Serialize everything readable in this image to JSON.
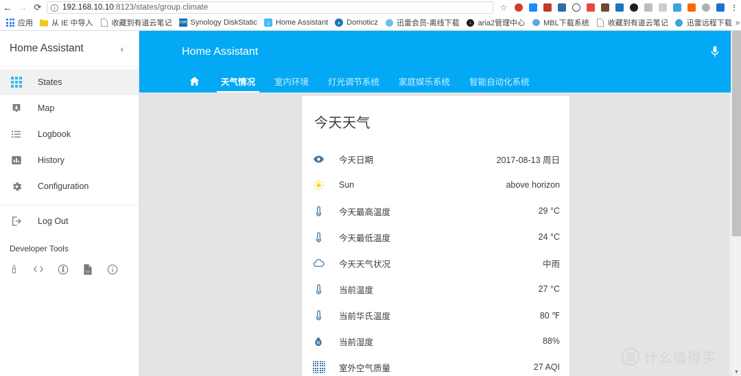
{
  "browser": {
    "back_icon": "back-arrow-icon",
    "forward_icon": "forward-arrow-icon",
    "reload_icon": "reload-icon",
    "url_host": "192.168.10.10",
    "url_rest": ":8123/states/group.climate",
    "url_full": "192.168.10.10:8123/states/group.climate",
    "star_icon": "bookmark-star-icon",
    "menu_icon": "browser-menu-icon",
    "extensions": [
      {
        "name": "evernote-extension",
        "color": "#d83c2a"
      },
      {
        "name": "pocket-extension",
        "color": "#1a8cff"
      },
      {
        "name": "speed-test-100-extension",
        "color": "#c0392b"
      },
      {
        "name": "image-downloader-extension",
        "color": "#2c6ea8"
      },
      {
        "name": "one-password-extension",
        "color": "#4a4a4a"
      },
      {
        "name": "dictionary-extension",
        "color": "#e8453c"
      },
      {
        "name": "ink-extension",
        "color": "#6b4a2a"
      },
      {
        "name": "sogou-extension",
        "color": "#1b75bb"
      },
      {
        "name": "chameleon-extension",
        "color": "#1f1f1f"
      },
      {
        "name": "elephant-extension",
        "color": "#b9bdc0"
      },
      {
        "name": "shield-extension",
        "color": "#b9bdc0"
      },
      {
        "name": "xunlei-extension",
        "color": "#3ba6dc"
      },
      {
        "name": "xiaomi-extension",
        "color": "#ff6700"
      },
      {
        "name": "moon-extension",
        "color": "#b0b0b0"
      },
      {
        "name": "bluetab-extension",
        "color": "#1f6fd0"
      }
    ]
  },
  "bookmarks": {
    "overflow_label": "»",
    "items": [
      {
        "label": "应用",
        "icon": "apps-grid-icon",
        "icon_color": "#4285f4"
      },
      {
        "label": "从 IE 中导入",
        "icon": "folder-icon",
        "icon_color": "#f5c518"
      },
      {
        "label": "收藏到有道云笔记",
        "icon": "page-icon",
        "icon_color": "#9aa0a6"
      },
      {
        "label": "Synology DiskStatic",
        "icon": "dsm-icon",
        "icon_color": "#1a6fb5"
      },
      {
        "label": "Home Assistant",
        "icon": "home-assistant-icon",
        "icon_color": "#41bdf5"
      },
      {
        "label": "Domoticz",
        "icon": "domoticz-icon",
        "icon_color": "#1b75bb"
      },
      {
        "label": "迅雷会员-离线下载",
        "icon": "thunder-member-icon",
        "icon_color": "#6cc0e8"
      },
      {
        "label": "aria2管理中心",
        "icon": "aria2-icon",
        "icon_color": "#1f1f1f"
      },
      {
        "label": "MBL下载系统",
        "icon": "mbl-icon",
        "icon_color": "#5aa9dd"
      },
      {
        "label": "收藏到有道云笔记",
        "icon": "page-icon",
        "icon_color": "#9aa0a6"
      },
      {
        "label": "迅雷远程下载",
        "icon": "thunder-remote-icon",
        "icon_color": "#3ba6dc"
      }
    ]
  },
  "sidebar": {
    "title": "Home Assistant",
    "collapse_icon": "chevron-left-icon",
    "items": [
      {
        "label": "States",
        "icon": "states-grid-icon",
        "active": true
      },
      {
        "label": "Map",
        "icon": "map-marker-icon",
        "active": false
      },
      {
        "label": "Logbook",
        "icon": "logbook-list-icon",
        "active": false
      },
      {
        "label": "History",
        "icon": "history-chart-icon",
        "active": false
      },
      {
        "label": "Configuration",
        "icon": "gear-icon",
        "active": false
      },
      {
        "label": "Log Out",
        "icon": "logout-icon",
        "active": false
      }
    ],
    "developer_tools": {
      "title": "Developer Tools",
      "icons": [
        {
          "name": "remote-services-icon"
        },
        {
          "name": "code-templates-icon"
        },
        {
          "name": "events-broadcast-icon"
        },
        {
          "name": "states-file-icon"
        },
        {
          "name": "info-icon"
        }
      ]
    }
  },
  "appbar": {
    "title": "Home Assistant",
    "mic_icon": "microphone-icon",
    "accent_color": "#03a9f4",
    "tabs": [
      {
        "label": "",
        "icon": "home-icon",
        "active": false
      },
      {
        "label": "天气情况",
        "active": true
      },
      {
        "label": "室内环境",
        "active": false
      },
      {
        "label": "灯光调节系统",
        "active": false
      },
      {
        "label": "家庭娱乐系统",
        "active": false
      },
      {
        "label": "智能自动化系统",
        "active": false
      }
    ]
  },
  "card": {
    "title": "今天天气",
    "rows": [
      {
        "icon": "eye-icon",
        "icon_color": "#44739e",
        "name": "今天日期",
        "value": "2017-08-13 周日"
      },
      {
        "icon": "sun-icon",
        "icon_color": "#fdd835",
        "name": "Sun",
        "value": "above horizon"
      },
      {
        "icon": "thermometer-icon",
        "icon_color": "#44739e",
        "name": "今天最高温度",
        "value": "29 °C"
      },
      {
        "icon": "thermometer-icon",
        "icon_color": "#44739e",
        "name": "今天最低温度",
        "value": "24 °C"
      },
      {
        "icon": "cloud-icon",
        "icon_color": "#44739e",
        "name": "今天天气状况",
        "value": "中雨"
      },
      {
        "icon": "thermometer-icon",
        "icon_color": "#44739e",
        "name": "当前温度",
        "value": "27 °C"
      },
      {
        "icon": "thermometer-icon",
        "icon_color": "#44739e",
        "name": "当前华氏温度",
        "value": "80 ℉"
      },
      {
        "icon": "water-percent-icon",
        "icon_color": "#44739e",
        "name": "当前湿度",
        "value": "88%"
      },
      {
        "icon": "air-filter-icon",
        "icon_color": "#44739e",
        "name": "室外空气质量",
        "value": "27 AQI"
      }
    ]
  },
  "watermark": {
    "badge": "值",
    "text": "什么值得买"
  },
  "scrollbar": {
    "down_arrow": "▼"
  }
}
